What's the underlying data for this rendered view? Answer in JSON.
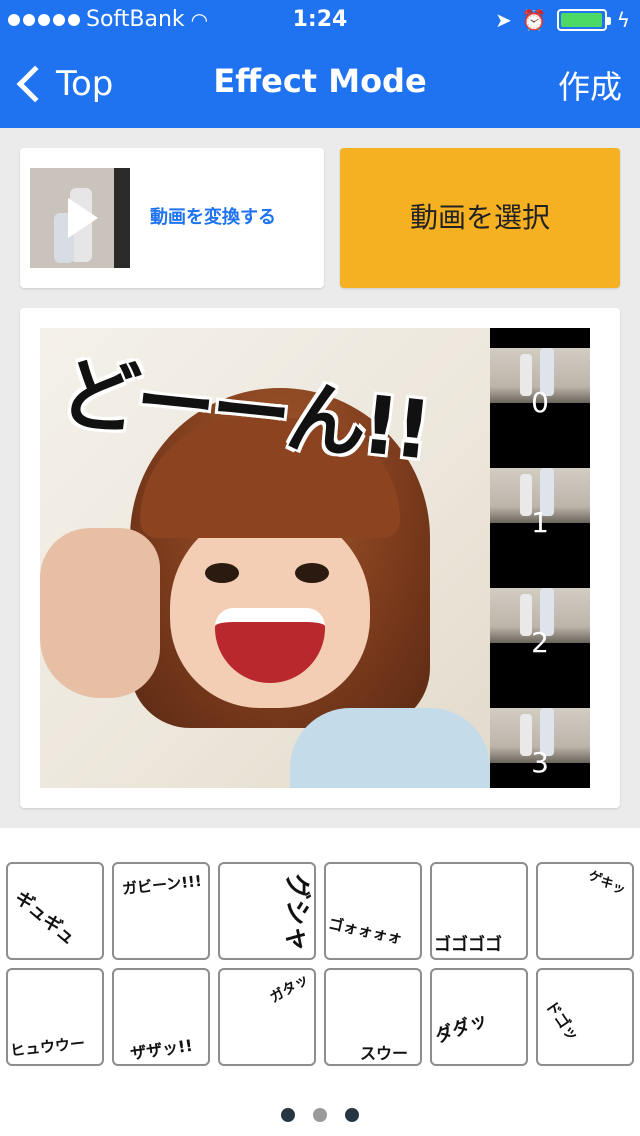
{
  "status": {
    "carrier": "SoftBank",
    "time": "1:24"
  },
  "nav": {
    "back_label": "Top",
    "title": "Effect Mode",
    "action_label": "作成"
  },
  "convert": {
    "label": "動画を変換する"
  },
  "select": {
    "label": "動画を選択"
  },
  "preview": {
    "effect_text": "どーーん!!"
  },
  "frames": [
    {
      "label": "0"
    },
    {
      "label": "1"
    },
    {
      "label": "2"
    },
    {
      "label": "3"
    }
  ],
  "effects": [
    {
      "label": "ギュギュ"
    },
    {
      "label": "ガビーン!!!"
    },
    {
      "label": "グシャ"
    },
    {
      "label": "ゴォォォォ"
    },
    {
      "label": "ゴゴゴゴ"
    },
    {
      "label": "ゲキッ"
    },
    {
      "label": "ヒュウウー"
    },
    {
      "label": "ザザッ!!"
    },
    {
      "label": "ガタッ"
    },
    {
      "label": "スウー"
    },
    {
      "label": "ダダッ"
    },
    {
      "label": "ドゴッ"
    }
  ],
  "pager": {
    "current": 2,
    "total": 3
  },
  "colors": {
    "nav_bg": "#1f73f0",
    "select_button": "#f5b121",
    "link": "#1f73f0",
    "battery": "#4cd964"
  }
}
